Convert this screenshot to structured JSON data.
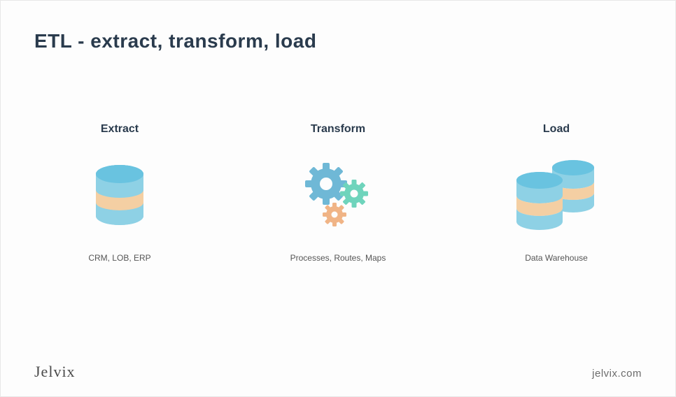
{
  "title": "ETL - extract, transform, load",
  "stages": [
    {
      "label": "Extract",
      "caption": "CRM, LOB, ERP"
    },
    {
      "label": "Transform",
      "caption": "Processes, Routes, Maps"
    },
    {
      "label": "Load",
      "caption": "Data Warehouse"
    }
  ],
  "footer": {
    "brand": "Jelvix",
    "url": "jelvix.com"
  },
  "colors": {
    "dbTop": "#69c3e0",
    "dbBody": "#8ed1e5",
    "dbBand": "#f4cfa3",
    "gearBlue": "#6fb8d6",
    "gearTeal": "#6fd4bc",
    "gearOrange": "#f0b486"
  }
}
